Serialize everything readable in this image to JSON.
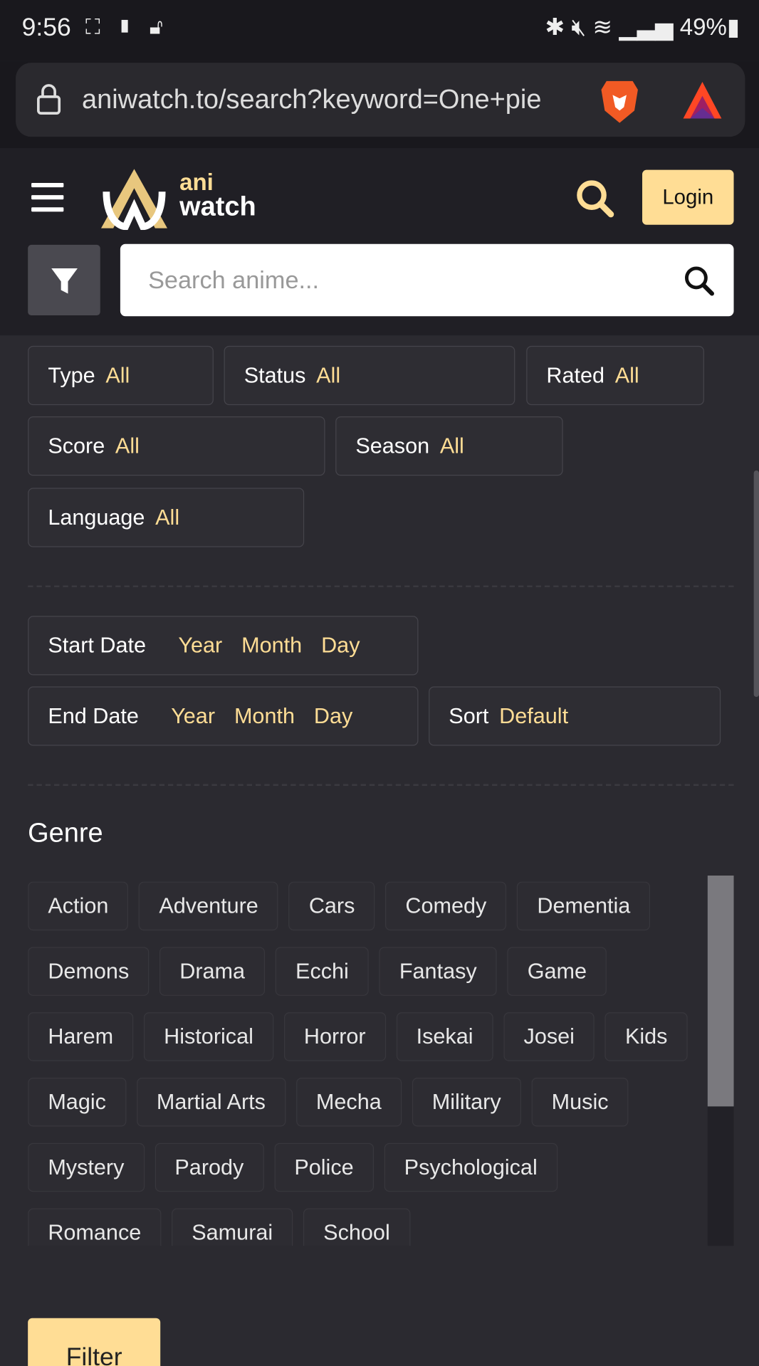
{
  "status_bar": {
    "time": "9:56",
    "battery": "49%"
  },
  "browser": {
    "url": "aniwatch.to/search?keyword=One+pie"
  },
  "header": {
    "logo_top": "ani",
    "logo_bottom": "watch",
    "login_label": "Login",
    "search_placeholder": "Search anime..."
  },
  "filters": {
    "type": {
      "label": "Type",
      "value": "All"
    },
    "status": {
      "label": "Status",
      "value": "All"
    },
    "rated": {
      "label": "Rated",
      "value": "All"
    },
    "score": {
      "label": "Score",
      "value": "All"
    },
    "season": {
      "label": "Season",
      "value": "All"
    },
    "language": {
      "label": "Language",
      "value": "All"
    },
    "start_date": {
      "label": "Start Date",
      "year": "Year",
      "month": "Month",
      "day": "Day"
    },
    "end_date": {
      "label": "End Date",
      "year": "Year",
      "month": "Month",
      "day": "Day"
    },
    "sort": {
      "label": "Sort",
      "value": "Default"
    }
  },
  "genre": {
    "title": "Genre",
    "items": [
      "Action",
      "Adventure",
      "Cars",
      "Comedy",
      "Dementia",
      "Demons",
      "Drama",
      "Ecchi",
      "Fantasy",
      "Game",
      "Harem",
      "Historical",
      "Horror",
      "Isekai",
      "Josei",
      "Kids",
      "Magic",
      "Martial Arts",
      "Mecha",
      "Military",
      "Music",
      "Mystery",
      "Parody",
      "Police",
      "Psychological",
      "Romance",
      "Samurai",
      "School"
    ]
  },
  "filter_button": "Filter",
  "colors": {
    "accent": "#ffdd95",
    "background": "#2b2a30",
    "header": "#201f25"
  }
}
